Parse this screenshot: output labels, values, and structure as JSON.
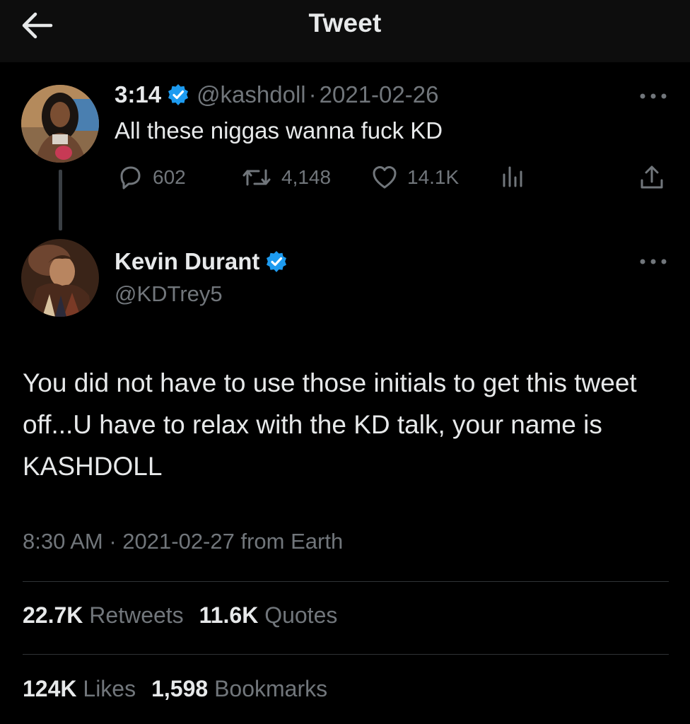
{
  "header": {
    "title": "Tweet",
    "back_icon": "arrow-left-icon"
  },
  "parent_tweet": {
    "name": "3:14",
    "handle": "@kashdoll",
    "separator": "·",
    "date": "2021-02-26",
    "text": "All these niggas wanna fuck KD",
    "actions": {
      "replies": "602",
      "retweets": "4,148",
      "likes": "14.1K"
    }
  },
  "main_tweet": {
    "name": "Kevin Durant",
    "handle": "@KDTrey5",
    "text": "You did not have to use those initials to get this tweet off...U have to relax with the KD talk, your name is KASHDOLL",
    "timestamp": "8:30 AM · 2021-02-27 from Earth"
  },
  "stats": {
    "retweets_count": "22.7K",
    "retweets_label": "Retweets",
    "quotes_count": "11.6K",
    "quotes_label": "Quotes",
    "likes_count": "124K",
    "likes_label": "Likes",
    "bookmarks_count": "1,598",
    "bookmarks_label": "Bookmarks"
  },
  "colors": {
    "background": "#000000",
    "header_bg": "#0d0d0d",
    "text_primary": "#e7e9ea",
    "text_secondary": "#71767b",
    "verified_blue": "#1d9bf0",
    "divider": "#2f3336"
  }
}
